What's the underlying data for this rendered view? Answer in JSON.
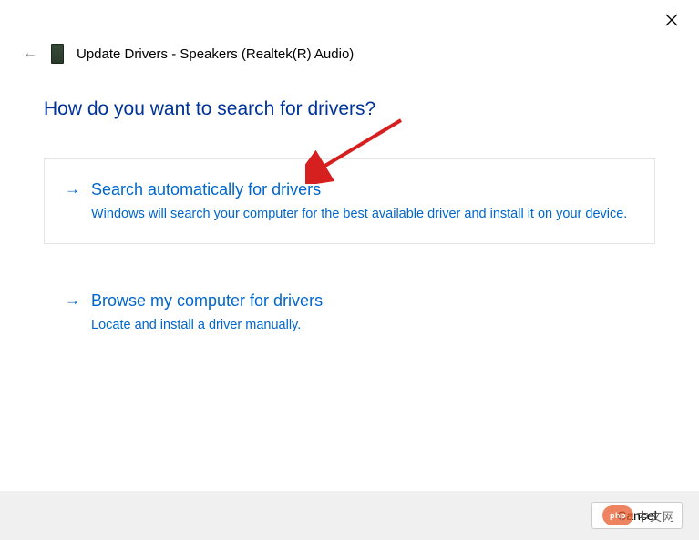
{
  "header": {
    "title": "Update Drivers - Speakers (Realtek(R) Audio)"
  },
  "heading": "How do you want to search for drivers?",
  "options": [
    {
      "title": "Search automatically for drivers",
      "description": "Windows will search your computer for the best available driver and install it on your device."
    },
    {
      "title": "Browse my computer for drivers",
      "description": "Locate and install a driver manually."
    }
  ],
  "footer": {
    "cancel_label": "Cancel"
  },
  "watermark": {
    "logo": "php",
    "text": "中文网"
  }
}
